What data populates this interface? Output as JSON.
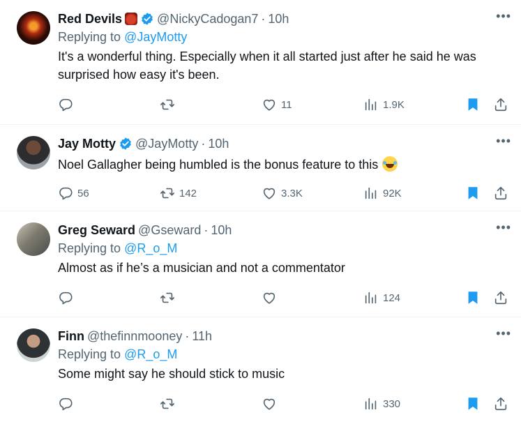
{
  "tweets": [
    {
      "name": "Red Devils",
      "handle": "@NickyCadogan7",
      "time": "10h",
      "replying_prefix": "Replying to ",
      "replying_to": "@JayMotty",
      "text": "It's a wonderful thing. Especially when it all started just after he said he was surprised how easy it's been.",
      "replies": "",
      "retweets": "",
      "likes": "11",
      "views": "1.9K",
      "bookmarked": true
    },
    {
      "name": "Jay Motty",
      "handle": "@JayMotty",
      "time": "10h",
      "text": "Noel Gallagher being humbled is the bonus feature to this",
      "replies": "56",
      "retweets": "142",
      "likes": "3.3K",
      "views": "92K",
      "bookmarked": true
    },
    {
      "name": "Greg Seward",
      "handle": "@Gseward",
      "time": "10h",
      "replying_prefix": "Replying to ",
      "replying_to": "@R_o_M",
      "text": "Almost as if he’s a musician and not a commentator",
      "replies": "",
      "retweets": "",
      "likes": "",
      "views": "124",
      "bookmarked": true
    },
    {
      "name": "Finn",
      "handle": "@thefinnmooney",
      "time": "11h",
      "replying_prefix": "Replying to ",
      "replying_to": "@R_o_M",
      "text": "Some might say he should stick to music",
      "replies": "",
      "retweets": "",
      "likes": "",
      "views": "330",
      "bookmarked": true
    }
  ],
  "separator": "·",
  "more_glyph": "•••",
  "colors": {
    "accent": "#1d9bf0",
    "muted": "#536471",
    "text": "#0f1419",
    "divider": "#eff3f4"
  },
  "icons": [
    "reply-icon",
    "retweet-icon",
    "like-icon",
    "views-icon",
    "bookmark-icon",
    "share-icon",
    "verified-badge-icon",
    "more-icon"
  ]
}
